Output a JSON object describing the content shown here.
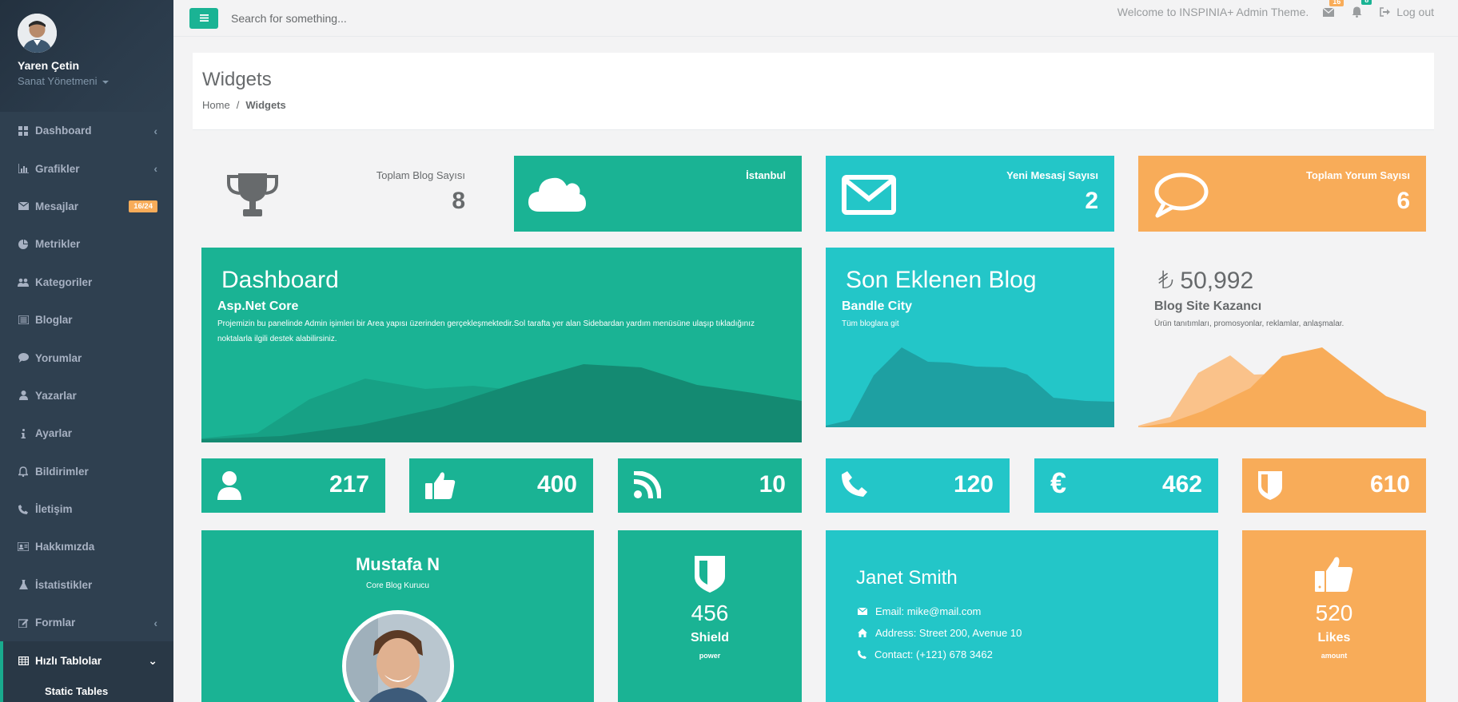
{
  "user": {
    "name": "Yaren Çetin",
    "role": "Sanat Yönetmeni"
  },
  "sidebar": {
    "items": [
      {
        "label": "Dashboard",
        "icon": "dashboard-icon",
        "chevron": "‹"
      },
      {
        "label": "Grafikler",
        "icon": "bar-chart-icon",
        "chevron": "‹"
      },
      {
        "label": "Mesajlar",
        "icon": "envelope-icon",
        "badge": "16/24"
      },
      {
        "label": "Metrikler",
        "icon": "pie-chart-icon"
      },
      {
        "label": "Kategoriler",
        "icon": "users-icon"
      },
      {
        "label": "Bloglar",
        "icon": "list-icon"
      },
      {
        "label": "Yorumlar",
        "icon": "comment-icon"
      },
      {
        "label": "Yazarlar",
        "icon": "user-icon"
      },
      {
        "label": "Ayarlar",
        "icon": "info-icon"
      },
      {
        "label": "Bildirimler",
        "icon": "bell-icon"
      },
      {
        "label": "İletişim",
        "icon": "phone-icon"
      },
      {
        "label": "Hakkımızda",
        "icon": "id-card-icon"
      },
      {
        "label": "İstatistikler",
        "icon": "flask-icon"
      },
      {
        "label": "Formlar",
        "icon": "edit-icon",
        "chevron": "‹"
      },
      {
        "label": "Hızlı Tablolar",
        "icon": "table-icon",
        "chevron": "⌄"
      }
    ],
    "subitem": "Static Tables"
  },
  "topbar": {
    "search_placeholder": "Search for something...",
    "welcome": "Welcome to INSPINIA+ Admin Theme.",
    "mail_count": "16",
    "bell_count": "8",
    "logout": "Log out"
  },
  "page": {
    "title": "Widgets",
    "breadcrumb": {
      "home": "Home",
      "sep": "/",
      "current": "Widgets"
    }
  },
  "stats": {
    "blog": {
      "label": "Toplam Blog Sayısı",
      "value": "8",
      "icon": "trophy-icon"
    },
    "weather": {
      "label": "İstanbul",
      "icon": "cloud-icon"
    },
    "messages": {
      "label": "Yeni Mesasj Sayısı",
      "value": "2",
      "icon": "envelope-icon"
    },
    "comments": {
      "label": "Toplam Yorum Sayısı",
      "value": "6",
      "icon": "comment-icon"
    }
  },
  "hero_dashboard": {
    "title": "Dashboard",
    "subtitle": "Asp.Net Core",
    "text": "Projemizin bu panelinde Admin işimleri bir Area yapısı üzerinden gerçekleşmektedir.Sol tarafta yer alan Sidebardan yardım menüsüne ulaşıp tıkladığınız noktalarla ilgili destek alabilirsiniz."
  },
  "hero_blog": {
    "title": "Son Eklenen Blog",
    "subtitle": "Bandle City",
    "text": "Tüm bloglara git"
  },
  "hero_earn": {
    "value": "₺ 50,992",
    "subtitle": "Blog Site Kazancı",
    "text": "Ürün tanıtımları, promosyonlar, reklamlar, anlaşmalar."
  },
  "mini": [
    {
      "icon": "user-icon",
      "value": "217",
      "color": "#1ab394"
    },
    {
      "icon": "thumbs-up-icon",
      "value": "400",
      "color": "#1ab394"
    },
    {
      "icon": "rss-icon",
      "value": "10",
      "color": "#1ab394"
    },
    {
      "icon": "phone-icon",
      "value": "120",
      "color": "#23c6c8"
    },
    {
      "icon": "euro-icon",
      "value": "462",
      "color": "#23c6c8"
    },
    {
      "icon": "shield-icon",
      "value": "610",
      "color": "#f8ac59"
    }
  ],
  "profile_card": {
    "name": "Mustafa N",
    "role": "Core Blog Kurucu"
  },
  "shield_card": {
    "value": "456",
    "label": "Shield",
    "sub": "power"
  },
  "contact_card": {
    "name": "Janet Smith",
    "email": "Email: mike@mail.com",
    "address": "Address: Street 200, Avenue 10",
    "phone": "Contact: (+121) 678 3462"
  },
  "likes_card": {
    "value": "520",
    "label": "Likes",
    "sub": "amount"
  },
  "colors": {
    "navy": "#1ab394",
    "lazur": "#23c6c8",
    "yellow": "#f8ac59",
    "sidebar": "#2f4050"
  }
}
